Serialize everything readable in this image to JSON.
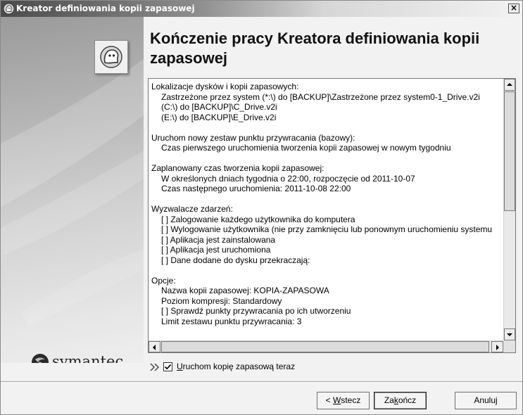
{
  "window": {
    "title": "Kreator definiowania kopii zapasowej"
  },
  "icons": {
    "app": "symantec-ghost-icon",
    "close": "close-icon",
    "wizard": "ghost-wizard-icon",
    "run_arrows": "double-arrow-icon"
  },
  "heading": "Kończenie pracy Kreatora definiowania kopii zapasowej",
  "summary": {
    "lines": [
      {
        "text": "Lokalizacje dysków i kopii zapasowych:",
        "indent": false
      },
      {
        "text": "Zastrzeżone przez system (*:\\) do [BACKUP]\\Zastrzeżone przez system0-1_Drive.v2i",
        "indent": true
      },
      {
        "text": "(C:\\) do [BACKUP]\\C_Drive.v2i",
        "indent": true
      },
      {
        "text": "(E:\\) do [BACKUP]\\E_Drive.v2i",
        "indent": true
      },
      {
        "text": "",
        "indent": false
      },
      {
        "text": "Uruchom nowy zestaw punktu przywracania (bazowy):",
        "indent": false
      },
      {
        "text": "Czas pierwszego uruchomienia tworzenia kopii zapasowej w nowym tygodniu",
        "indent": true
      },
      {
        "text": "",
        "indent": false
      },
      {
        "text": "Zaplanowany czas tworzenia kopii zapasowej:",
        "indent": false
      },
      {
        "text": "W określonych dniach tygodnia o 22:00, rozpoczęcie od 2011-10-07",
        "indent": true
      },
      {
        "text": "Czas następnego uruchomienia: 2011-10-08 22:00",
        "indent": true
      },
      {
        "text": "",
        "indent": false
      },
      {
        "text": "Wyzwalacze zdarzeń:",
        "indent": false
      },
      {
        "text": "[ ] Zalogowanie każdego użytkownika do komputera",
        "indent": true
      },
      {
        "text": "[ ] Wylogowanie użytkownika (nie przy zamknięciu lub ponownym uruchomieniu systemu",
        "indent": true
      },
      {
        "text": "[ ] Aplikacja jest zainstalowana",
        "indent": true
      },
      {
        "text": "[ ] Aplikacja jest uruchomiona",
        "indent": true
      },
      {
        "text": "[ ] Dane dodane do dysku przekraczają:",
        "indent": true
      },
      {
        "text": "",
        "indent": false
      },
      {
        "text": "Opcje:",
        "indent": false
      },
      {
        "text": "Nazwa kopii zapasowej: KOPIA-ZAPASOWA",
        "indent": true
      },
      {
        "text": "Poziom kompresji: Standardowy",
        "indent": true
      },
      {
        "text": "[ ] Sprawdź punkty przywracania po ich utworzeniu",
        "indent": true
      },
      {
        "text": "Limit zestawu punktu przywracania: 3",
        "indent": true
      }
    ]
  },
  "run_now": {
    "label_u": "U",
    "label_rest": "ruchom kopię zapasową teraz",
    "checked": true
  },
  "brand": {
    "name": "symantec."
  },
  "buttons": {
    "back": {
      "prefix": "< ",
      "u": "W",
      "rest": "stecz"
    },
    "finish": {
      "prefix": "Za",
      "u": "k",
      "rest": "ończ"
    },
    "cancel": {
      "label": "Anuluj"
    }
  }
}
